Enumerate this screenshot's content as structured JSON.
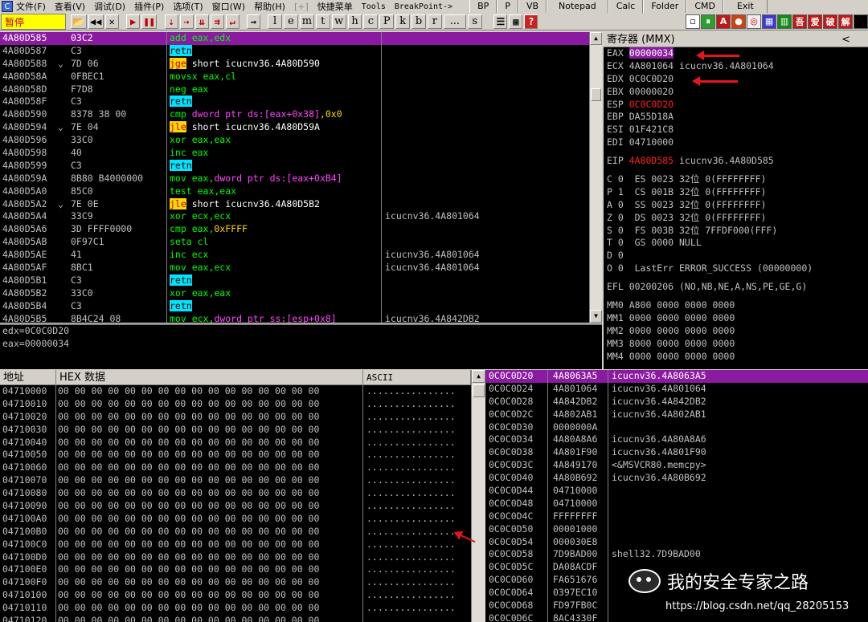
{
  "menubar": {
    "items": [
      "文件(F)",
      "查看(V)",
      "调试(D)",
      "插件(P)",
      "选项(T)",
      "窗口(W)",
      "帮助(H)"
    ],
    "plus": "[+]",
    "extras": [
      "快捷菜单",
      "Tools",
      "BreakPoint->"
    ],
    "buttons": [
      "BP",
      "P",
      "VB",
      "Notepad",
      "Calc",
      "Folder",
      "CMD",
      "Exit"
    ]
  },
  "toolbar": {
    "status": "暂停",
    "letters": [
      "l",
      "e",
      "m",
      "t",
      "w",
      "h",
      "c",
      "P",
      "k",
      "b",
      "r",
      "...",
      "s"
    ],
    "plugins": [
      "A",
      "吾",
      "爱",
      "破",
      "解"
    ]
  },
  "disasm": {
    "rows": [
      {
        "addr": "4A80D585",
        "mark": "",
        "hex": "03C2",
        "asm": [
          {
            "t": "add eax,edx",
            "c": "k-add"
          }
        ],
        "cmt": "",
        "sel": true
      },
      {
        "addr": "4A80D587",
        "mark": "",
        "hex": "C3",
        "asm": [
          {
            "t": "retn",
            "c": "k-retn"
          }
        ],
        "cmt": ""
      },
      {
        "addr": "4A80D588",
        "mark": "⌄",
        "hex": "7D 06",
        "asm": [
          {
            "t": "jge",
            "c": "k-jmp"
          },
          {
            "t": " short icucnv36.4A80D590",
            "c": "k-jtxt"
          }
        ],
        "cmt": ""
      },
      {
        "addr": "4A80D58A",
        "mark": "",
        "hex": "0FBEC1",
        "asm": [
          {
            "t": "movsx eax,cl",
            "c": "k-movsx"
          }
        ],
        "cmt": ""
      },
      {
        "addr": "4A80D58D",
        "mark": "",
        "hex": "F7D8",
        "asm": [
          {
            "t": "neg eax",
            "c": "k-neg"
          }
        ],
        "cmt": ""
      },
      {
        "addr": "4A80D58F",
        "mark": "",
        "hex": "C3",
        "asm": [
          {
            "t": "retn",
            "c": "k-retn"
          }
        ],
        "cmt": ""
      },
      {
        "addr": "4A80D590",
        "mark": "",
        "hex": "8378 38 00",
        "asm": [
          {
            "t": "cmp ",
            "c": "k-cmp"
          },
          {
            "t": "dword ptr ds:[eax+0x38]",
            "c": "k-mem"
          },
          {
            "t": ",0x0",
            "c": "k-const"
          }
        ],
        "cmt": ""
      },
      {
        "addr": "4A80D594",
        "mark": "⌄",
        "hex": "7E 04",
        "asm": [
          {
            "t": "jle",
            "c": "k-jmp"
          },
          {
            "t": " short icucnv36.4A80D59A",
            "c": "k-jtxt"
          }
        ],
        "cmt": ""
      },
      {
        "addr": "4A80D596",
        "mark": "",
        "hex": "33C0",
        "asm": [
          {
            "t": "xor eax,eax",
            "c": "k-xor"
          }
        ],
        "cmt": ""
      },
      {
        "addr": "4A80D598",
        "mark": "",
        "hex": "40",
        "asm": [
          {
            "t": "inc eax",
            "c": "k-inc"
          }
        ],
        "cmt": ""
      },
      {
        "addr": "4A80D599",
        "mark": "",
        "hex": "C3",
        "asm": [
          {
            "t": "retn",
            "c": "k-retn"
          }
        ],
        "cmt": ""
      },
      {
        "addr": "4A80D59A",
        "mark": "",
        "hex": "8B80 B4000000",
        "asm": [
          {
            "t": "mov eax,",
            "c": "k-mov"
          },
          {
            "t": "dword ptr ds:[eax+0xB4]",
            "c": "k-mem"
          }
        ],
        "cmt": ""
      },
      {
        "addr": "4A80D5A0",
        "mark": "",
        "hex": "85C0",
        "asm": [
          {
            "t": "test eax,eax",
            "c": "k-test"
          }
        ],
        "cmt": ""
      },
      {
        "addr": "4A80D5A2",
        "mark": "⌄",
        "hex": "7E 0E",
        "asm": [
          {
            "t": "jle",
            "c": "k-jmp"
          },
          {
            "t": " short icucnv36.4A80D5B2",
            "c": "k-jtxt"
          }
        ],
        "cmt": ""
      },
      {
        "addr": "4A80D5A4",
        "mark": "",
        "hex": "33C9",
        "asm": [
          {
            "t": "xor ecx,ecx",
            "c": "k-xor"
          }
        ],
        "cmt": "icucnv36.4A801064"
      },
      {
        "addr": "4A80D5A6",
        "mark": "",
        "hex": "3D FFFF0000",
        "asm": [
          {
            "t": "cmp eax,",
            "c": "k-cmp"
          },
          {
            "t": "0xFFFF",
            "c": "k-const"
          }
        ],
        "cmt": ""
      },
      {
        "addr": "4A80D5AB",
        "mark": "",
        "hex": "0F97C1",
        "asm": [
          {
            "t": "seta cl",
            "c": "k-seta"
          }
        ],
        "cmt": ""
      },
      {
        "addr": "4A80D5AE",
        "mark": "",
        "hex": "41",
        "asm": [
          {
            "t": "inc ecx",
            "c": "k-inc"
          }
        ],
        "cmt": "icucnv36.4A801064"
      },
      {
        "addr": "4A80D5AF",
        "mark": "",
        "hex": "8BC1",
        "asm": [
          {
            "t": "mov eax,ecx",
            "c": "k-mov"
          }
        ],
        "cmt": "icucnv36.4A801064"
      },
      {
        "addr": "4A80D5B1",
        "mark": "",
        "hex": "C3",
        "asm": [
          {
            "t": "retn",
            "c": "k-retn"
          }
        ],
        "cmt": ""
      },
      {
        "addr": "4A80D5B2",
        "mark": "",
        "hex": "33C0",
        "asm": [
          {
            "t": "xor eax,eax",
            "c": "k-xor"
          }
        ],
        "cmt": ""
      },
      {
        "addr": "4A80D5B4",
        "mark": "",
        "hex": "C3",
        "asm": [
          {
            "t": "retn",
            "c": "k-retn"
          }
        ],
        "cmt": ""
      },
      {
        "addr": "4A80D5B5",
        "mark": "",
        "hex": "8B4C24 08",
        "asm": [
          {
            "t": "mov ecx,",
            "c": "k-mov"
          },
          {
            "t": "dword ptr ss:[esp+0x8]",
            "c": "k-mem"
          }
        ],
        "cmt": "icucnv36.4A842DB2"
      }
    ]
  },
  "info": {
    "lines": [
      "edx=0C0C0D20",
      "eax=00000034"
    ]
  },
  "registers": {
    "title": "寄存器 (MMX)",
    "chevron": "<",
    "eax": {
      "name": "EAX",
      "value": "00000034"
    },
    "ecx": {
      "name": "ECX",
      "value": "4A801064 icucnv36.4A801064"
    },
    "edx": {
      "name": "EDX",
      "value": "0C0C0D20"
    },
    "ebx": {
      "name": "EBX",
      "value": "00000020"
    },
    "esp": {
      "name": "ESP",
      "value": "0C0C0D20"
    },
    "ebp": {
      "name": "EBP",
      "value": "DA55D18A"
    },
    "esi": {
      "name": "ESI",
      "value": "01F421C8"
    },
    "edi": {
      "name": "EDI",
      "value": "04710000"
    },
    "eip": {
      "name": "EIP",
      "value": "4A80D585",
      "tail": " icucnv36.4A80D585"
    },
    "flags": [
      "C 0  ES 0023 32位 0(FFFFFFFF)",
      "P 1  CS 001B 32位 0(FFFFFFFF)",
      "A 0  SS 0023 32位 0(FFFFFFFF)",
      "Z 0  DS 0023 32位 0(FFFFFFFF)",
      "S 0  FS 003B 32位 7FFDF000(FFF)",
      "T 0  GS 0000 NULL",
      "D 0",
      "O 0  LastErr ERROR_SUCCESS (00000000)"
    ],
    "efl": "EFL 00200206 (NO,NB,NE,A,NS,PE,GE,G)",
    "mmx": [
      "MM0 A800 0000 0000 0000",
      "MM1 0000 0000 0000 0000",
      "MM2 0000 0000 0000 0000",
      "MM3 8000 0000 0000 0000",
      "MM4 0000 0000 0000 0000"
    ]
  },
  "dump": {
    "header": {
      "addr": "地址",
      "hex": "HEX 数据",
      "ascii": "ASCII"
    },
    "hex_line": "00 00 00 00 00 00 00 00 00 00 00 00 00 00 00 00",
    "ascii_line": "................",
    "addrs": [
      "04710000",
      "04710010",
      "04710020",
      "04710030",
      "04710040",
      "04710050",
      "04710060",
      "04710070",
      "04710080",
      "04710090",
      "047100A0",
      "047100B0",
      "047100C0",
      "047100D0",
      "047100E0",
      "047100F0",
      "04710100",
      "04710110",
      "04710120"
    ]
  },
  "stack": {
    "rows": [
      {
        "addr": "0C0C0D20",
        "val": "4A8063A5",
        "cmt": "icucnv36.4A8063A5",
        "sel": true
      },
      {
        "addr": "0C0C0D24",
        "val": "4A801064",
        "cmt": "icucnv36.4A801064"
      },
      {
        "addr": "0C0C0D28",
        "val": "4A842DB2",
        "cmt": "icucnv36.4A842DB2"
      },
      {
        "addr": "0C0C0D2C",
        "val": "4A802AB1",
        "cmt": "icucnv36.4A802AB1"
      },
      {
        "addr": "0C0C0D30",
        "val": "0000000A",
        "cmt": ""
      },
      {
        "addr": "0C0C0D34",
        "val": "4A80A8A6",
        "cmt": "icucnv36.4A80A8A6"
      },
      {
        "addr": "0C0C0D38",
        "val": "4A801F90",
        "cmt": "icucnv36.4A801F90"
      },
      {
        "addr": "0C0C0D3C",
        "val": "4A849170",
        "cmt": "<&MSVCR80.memcpy>"
      },
      {
        "addr": "0C0C0D40",
        "val": "4A80B692",
        "cmt": "icucnv36.4A80B692"
      },
      {
        "addr": "0C0C0D44",
        "val": "04710000",
        "cmt": ""
      },
      {
        "addr": "0C0C0D48",
        "val": "04710000",
        "cmt": ""
      },
      {
        "addr": "0C0C0D4C",
        "val": "FFFFFFFF",
        "cmt": ""
      },
      {
        "addr": "0C0C0D50",
        "val": "00001000",
        "cmt": ""
      },
      {
        "addr": "0C0C0D54",
        "val": "000030E8",
        "cmt": ""
      },
      {
        "addr": "0C0C0D58",
        "val": "7D9BAD00",
        "cmt": "shell32.7D9BAD00"
      },
      {
        "addr": "0C0C0D5C",
        "val": "DA08ACDF",
        "cmt": ""
      },
      {
        "addr": "0C0C0D60",
        "val": "FA651676",
        "cmt": ""
      },
      {
        "addr": "0C0C0D64",
        "val": "0397EC10",
        "cmt": ""
      },
      {
        "addr": "0C0C0D68",
        "val": "FD97FB0C",
        "cmt": ""
      },
      {
        "addr": "0C0C0D6C",
        "val": "8AC4330F",
        "cmt": ""
      }
    ]
  },
  "watermark": {
    "text": "我的安全专家之路",
    "url": "https://blog.csdn.net/qq_28205153"
  },
  "colors": {
    "selection": "#8a1aa0",
    "annotation": "#e8141c",
    "retn": "#00e5ff",
    "jump": "#ffd700"
  }
}
